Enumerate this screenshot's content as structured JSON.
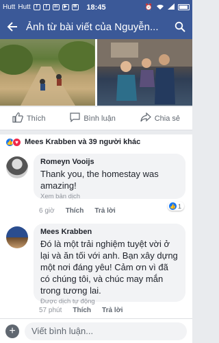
{
  "status": {
    "carrier1": "Hutt",
    "carrier2": "Hutt",
    "time": "18:45"
  },
  "appbar": {
    "title": "Ảnh từ bài viết của Nguyễn..."
  },
  "actions": {
    "like": "Thích",
    "comment": "Bình luận",
    "share": "Chia sẻ"
  },
  "reactions": {
    "summary": "Mees Krabben và 39 người khác"
  },
  "comments": [
    {
      "author": "Romeyn Vooijs",
      "text": "Thank you, the homestay was amazing!",
      "translation_link": "Xem bản dịch",
      "time": "6 giờ",
      "like_label": "Thích",
      "reply_label": "Trả lời",
      "like_count": "1"
    },
    {
      "author": "Mees Krabben",
      "text": "Đó là một trải nghiệm tuyệt vời ở lại và ăn tối với anh. Bạn xây dựng một nơi đáng yêu! Cảm ơn vì đã có chúng tôi, và chúc may mắn trong tương lai.",
      "translation_note": "Được dịch tự động",
      "time": "57 phút",
      "like_label": "Thích",
      "reply_label": "Trả lời"
    }
  ],
  "composer": {
    "placeholder": "Viết bình luận..."
  },
  "colors": {
    "brand": "#3b5998",
    "like": "#1877f2",
    "love": "#f0284a"
  }
}
